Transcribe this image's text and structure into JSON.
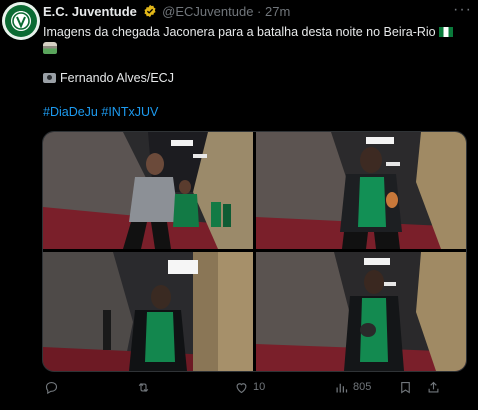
{
  "author": {
    "name": "E.C. Juventude",
    "handle": "@ECJuventude",
    "separator": "·",
    "time": "27m"
  },
  "tweet": {
    "line1": "Imagens da chegada Jaconera para a batalha desta noite no Beira-Rio",
    "credit": "Fernando Alves/ECJ",
    "hashtags": "#DiaDeJu #INTxJUV"
  },
  "media": [
    {
      "icon": "photo"
    },
    {
      "icon": "photo"
    },
    {
      "icon": "photo"
    },
    {
      "icon": "photo"
    }
  ],
  "actions": {
    "reply_count": "",
    "retweet_count": "",
    "like_count": "10",
    "views_count": "805"
  },
  "colors": {
    "background": "#000000",
    "text": "#e7e9ea",
    "muted": "#71767b",
    "link": "#1d9bf0",
    "verified": "#e2b719",
    "brand_green": "#0b6b33"
  }
}
